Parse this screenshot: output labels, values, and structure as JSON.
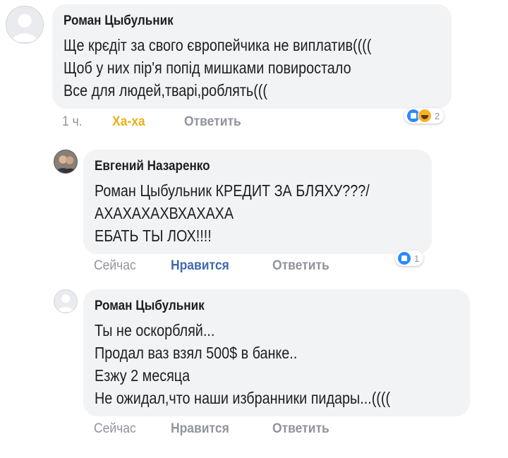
{
  "comments": [
    {
      "author": "Роман Цыбульник",
      "lines": [
        "Ще крєдіт за свого європейчика не виплатив((((",
        "Щоб у них пір'я попід мишками повиростало",
        "Все для людей,тварі,роблять((("
      ],
      "time": "1 ч.",
      "reaction_label": "Ха-ха",
      "reply_label": "Ответить",
      "reactions": {
        "icons": [
          "like-icon",
          "haha-icon"
        ],
        "count": "2"
      }
    },
    {
      "author": "Евгений Назаренко",
      "lines": [
        "Роман Цыбульник КРЕДИТ ЗА БЛЯХУ???/",
        "АХАХАХАХВХАХАХА",
        "ЕБАТЬ ТЫ ЛОХ!!!!"
      ],
      "time": "Сейчас",
      "reaction_label": "Нравится",
      "reply_label": "Ответить",
      "reactions": {
        "icons": [
          "like-icon"
        ],
        "count": "1"
      }
    },
    {
      "author": "Роман Цыбульник",
      "lines": [
        "Ты не оскорбляй...",
        "Продал ваз взял 500$ в банке..",
        "Езжу 2 месяца",
        "Не ожидал,что наши избранники пидары...(((("
      ],
      "time": "Сейчас",
      "reaction_label": "Нравится",
      "reply_label": "Ответить"
    }
  ],
  "colors": {
    "bubble": "#f2f3f5",
    "meta_grey": "#90949c",
    "like_blue": "#4267b2",
    "haha_yellow": "#e9b21a"
  }
}
